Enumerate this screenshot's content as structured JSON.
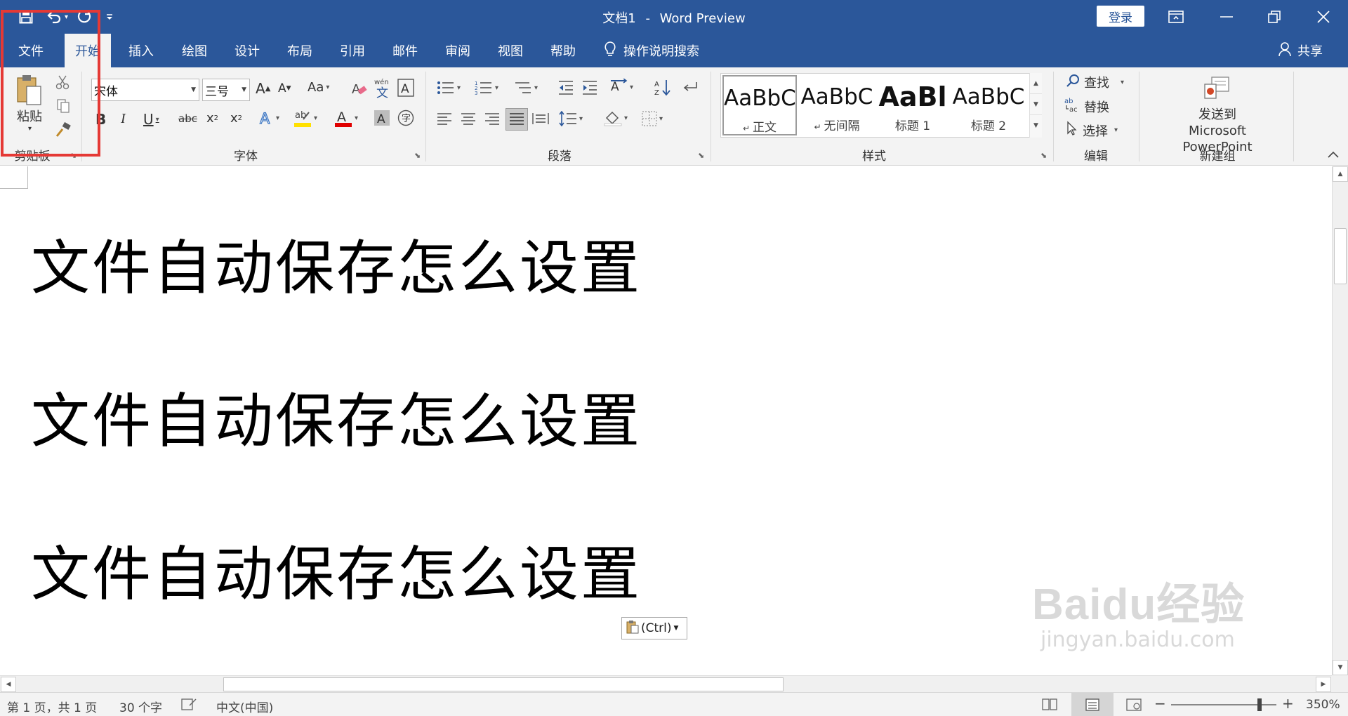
{
  "title_bar": {
    "document_name": "文档1",
    "separator": "-",
    "app_name": "Word Preview",
    "login_label": "登录"
  },
  "tabs": [
    {
      "label": "文件"
    },
    {
      "label": "开始",
      "active": true
    },
    {
      "label": "插入"
    },
    {
      "label": "绘图"
    },
    {
      "label": "设计"
    },
    {
      "label": "布局"
    },
    {
      "label": "引用"
    },
    {
      "label": "邮件"
    },
    {
      "label": "审阅"
    },
    {
      "label": "视图"
    },
    {
      "label": "帮助"
    }
  ],
  "tell_me": "操作说明搜索",
  "share_label": "共享",
  "ribbon": {
    "clipboard": {
      "paste_label": "粘贴",
      "group_label": "剪贴板"
    },
    "font": {
      "font_name": "宋体",
      "font_size": "三号",
      "change_case": "Aa",
      "group_label": "字体"
    },
    "paragraph": {
      "group_label": "段落"
    },
    "styles": {
      "items": [
        {
          "preview": "AaBbC",
          "name": "正文",
          "mark": "↵",
          "selected": true
        },
        {
          "preview": "AaBbC",
          "name": "无间隔",
          "mark": "↵"
        },
        {
          "preview": "AaBl",
          "name": "标题 1"
        },
        {
          "preview": "AaBbC",
          "name": "标题 2"
        }
      ],
      "group_label": "样式"
    },
    "editing": {
      "find_label": "查找",
      "replace_label": "替换",
      "select_label": "选择",
      "group_label": "编辑"
    },
    "new_group": {
      "send_label": "发送到",
      "send_target": "Microsoft PowerPoint",
      "group_label": "新建组"
    }
  },
  "document": {
    "paragraphs": [
      "文件自动保存怎么设置",
      "文件自动保存怎么设置",
      "文件自动保存怎么设置"
    ],
    "paste_options_label": "(Ctrl)"
  },
  "watermark": {
    "brand": "Baidu经验",
    "url": "jingyan.baidu.com"
  },
  "status_bar": {
    "page_info": "第 1 页，共 1 页",
    "word_count": "30 个字",
    "language": "中文(中国)",
    "zoom_level": "350%",
    "zoom_fraction": 0.84
  },
  "colors": {
    "title_bar": "#2b579a",
    "ribbon_bg": "#f3f3f3",
    "highlight_box": "#e53935",
    "font_color_swatch": "#e00000",
    "highlight_swatch": "#ffe000"
  }
}
